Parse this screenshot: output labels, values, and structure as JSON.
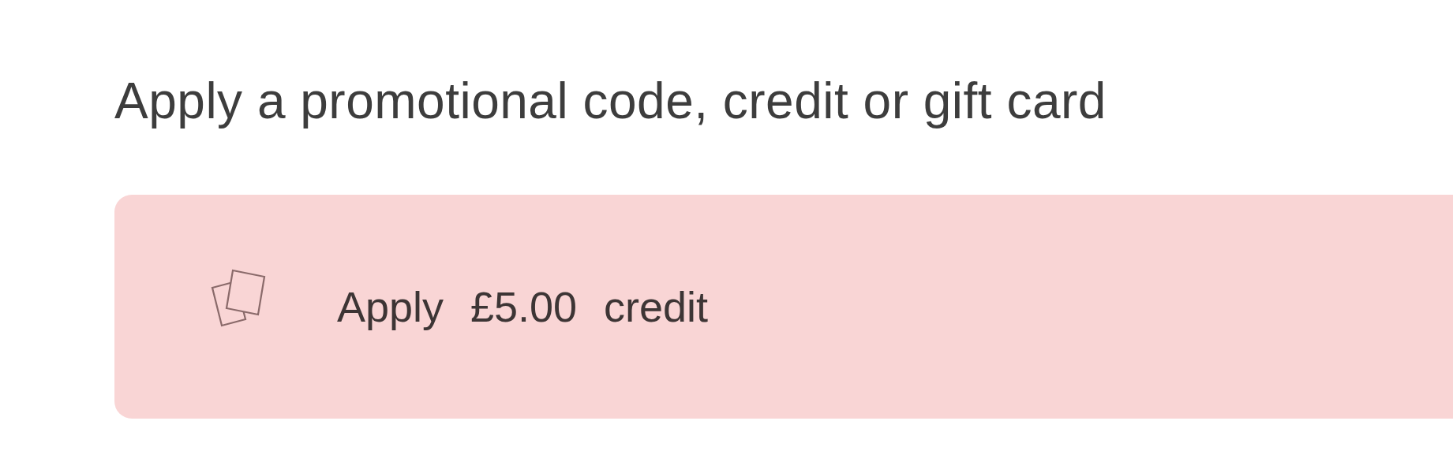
{
  "heading": "Apply a promotional code, credit or gift card",
  "credit_button": {
    "label": "Apply £5.00 credit"
  }
}
